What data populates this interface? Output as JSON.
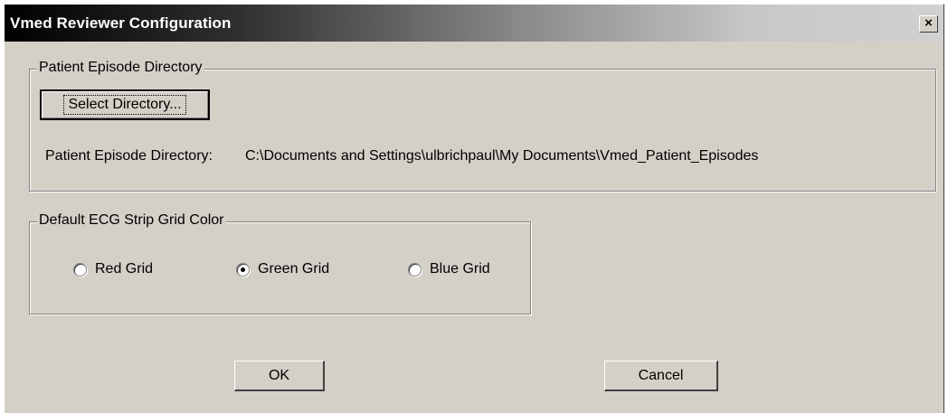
{
  "window": {
    "title": "Vmed Reviewer Configuration",
    "close_glyph": "×"
  },
  "directory_group": {
    "legend": "Patient Episode Directory",
    "select_button_label": "Select Directory...",
    "path_label": "Patient Episode Directory:",
    "path_value": "C:\\Documents and Settings\\ulbrichpaul\\My Documents\\Vmed_Patient_Episodes"
  },
  "grid_group": {
    "legend": "Default ECG Strip Grid Color",
    "options": [
      {
        "label": "Red Grid",
        "checked": false
      },
      {
        "label": "Green Grid",
        "checked": true
      },
      {
        "label": "Blue Grid",
        "checked": false
      }
    ]
  },
  "buttons": {
    "ok_label": "OK",
    "cancel_label": "Cancel"
  }
}
